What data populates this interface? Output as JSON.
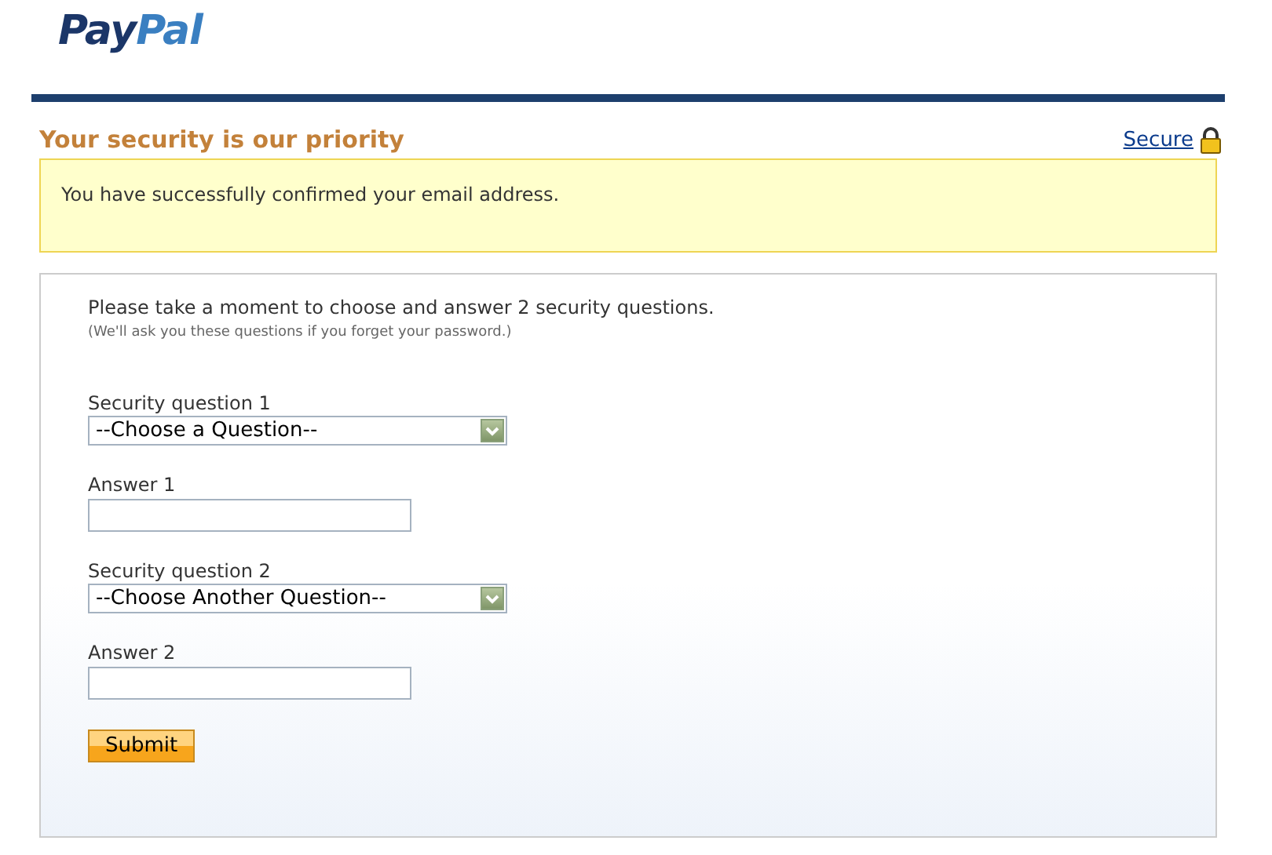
{
  "logo": [
    "Pay",
    "Pal"
  ],
  "heading": "Your security is our priority",
  "secure_link": "Secure",
  "notice": "You have successfully confirmed your email address.",
  "intro": "Please take a moment to choose and answer 2 security questions.",
  "hint": "(We'll ask you these questions if you forget your password.)",
  "fields": [
    {
      "kind": "select",
      "label": "Security question 1",
      "value": "--Choose a Question--"
    },
    {
      "kind": "text",
      "label": "Answer 1"
    },
    {
      "kind": "select",
      "label": "Security question 2",
      "value": "--Choose Another Question--"
    },
    {
      "kind": "text",
      "label": "Answer 2"
    }
  ],
  "submit": "Submit"
}
